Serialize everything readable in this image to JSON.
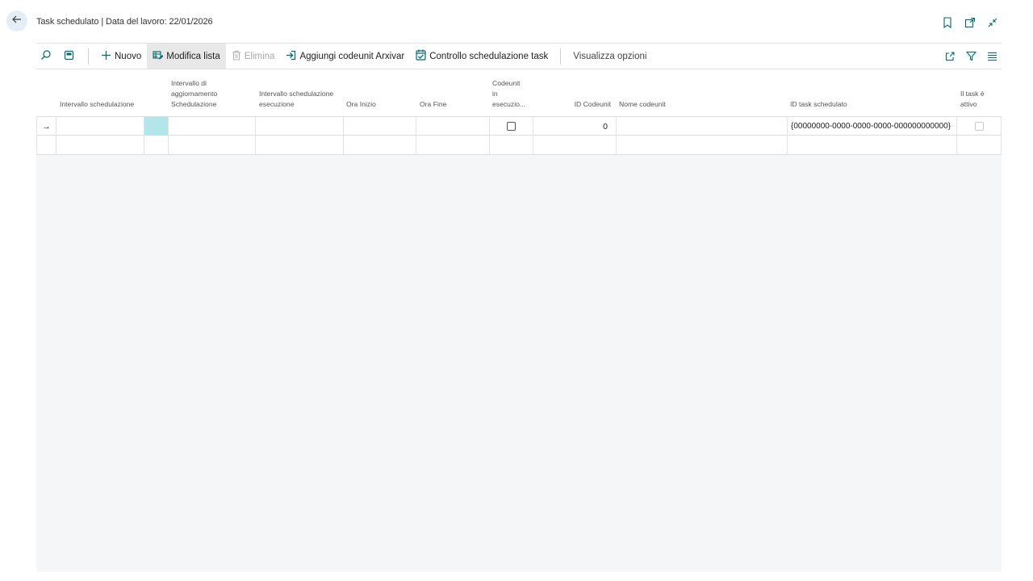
{
  "header": {
    "title": "Task schedulato | Data del lavoro: 22/01/2026"
  },
  "actions": {
    "new_label": "Nuovo",
    "edit_list_label": "Modifica lista",
    "delete_label": "Elimina",
    "add_codeunit_label": "Aggiungi codeunit Arxivar",
    "schedule_check_label": "Controllo schedulazione task",
    "view_options_label": "Visualizza opzioni"
  },
  "columns": {
    "schedule_interval": "Intervallo schedulazione",
    "update_interval_l1": "Intervallo di",
    "update_interval_l2": "aggiornamento",
    "update_interval_l3": "Schedulazione",
    "exec_interval_l1": "Intervallo schedulazione",
    "exec_interval_l2": "esecuzione",
    "start_time": "Ora Inizio",
    "end_time": "Ora Fine",
    "codeunit_running_l1": "Codeunit",
    "codeunit_running_l2": "in",
    "codeunit_running_l3": "esecuzio...",
    "codeunit_id": "ID Codeunit",
    "codeunit_name": "Nome codeunit",
    "task_id": "ID task schedulato",
    "task_active_l1": "Il task è",
    "task_active_l2": "attivo"
  },
  "rows": [
    {
      "row_marker": "→",
      "schedule_interval": "",
      "update_interval": "",
      "exec_interval": "",
      "start_time": "",
      "end_time": "",
      "codeunit_running": false,
      "codeunit_id": "0",
      "codeunit_name": "",
      "task_id": "{00000000-0000-0000-0000-000000000000}",
      "task_active": false
    }
  ],
  "colors": {
    "accent": "#00696f",
    "selected_cell": "#b3e6ea",
    "back_button_bg": "#e3eef6",
    "workspace_bg": "#f5f6f8"
  }
}
